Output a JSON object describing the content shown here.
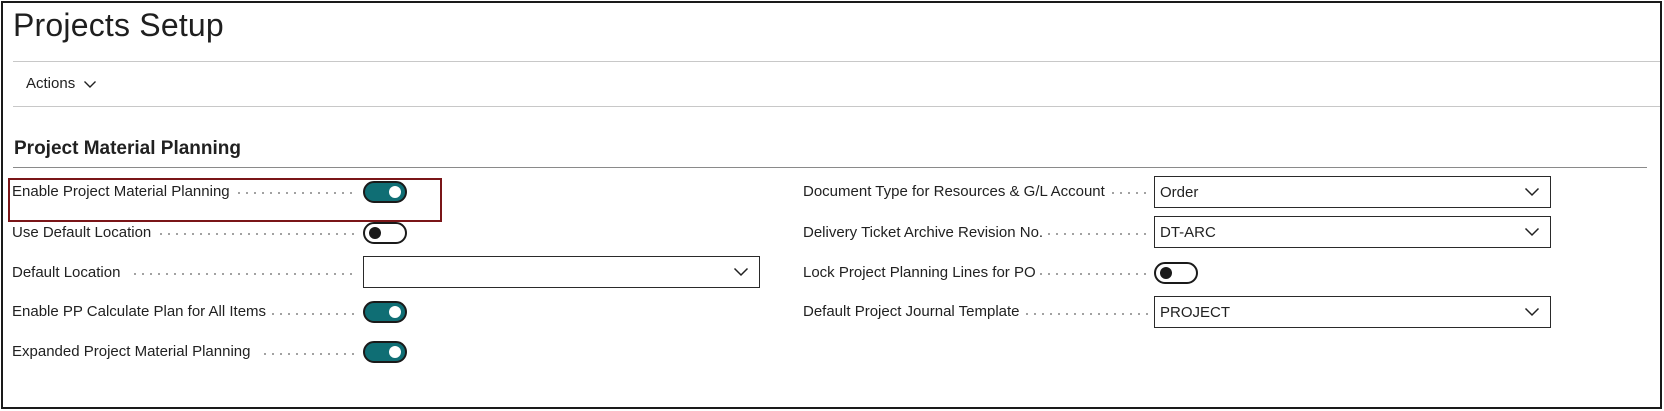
{
  "page": {
    "title": "Projects Setup"
  },
  "actions": {
    "label": "Actions"
  },
  "section": {
    "title": "Project Material Planning"
  },
  "left_fields": [
    {
      "label": "Enable Project Material Planning",
      "type": "toggle",
      "value": true
    },
    {
      "label": "Use Default Location",
      "type": "toggle",
      "value": false
    },
    {
      "label": "Default Location",
      "type": "select",
      "value": ""
    },
    {
      "label": "Enable PP Calculate Plan for All Items",
      "type": "toggle",
      "value": true
    },
    {
      "label": "Expanded Project Material Planning",
      "type": "toggle",
      "value": true
    }
  ],
  "right_fields": [
    {
      "label": "Document Type for Resources & G/L Account",
      "type": "select",
      "value": "Order"
    },
    {
      "label": "Delivery Ticket Archive Revision No.",
      "type": "select",
      "value": "DT-ARC"
    },
    {
      "label": "Lock Project Planning Lines for PO",
      "type": "toggle",
      "value": false
    },
    {
      "label": "Default Project Journal Template",
      "type": "select",
      "value": "PROJECT"
    }
  ],
  "colors": {
    "toggle_on": "#0f6e74",
    "highlight": "#7a1518"
  },
  "icons": {
    "actions_chevron": "chevron-down-icon",
    "select_chevron": "chevron-down-icon"
  }
}
